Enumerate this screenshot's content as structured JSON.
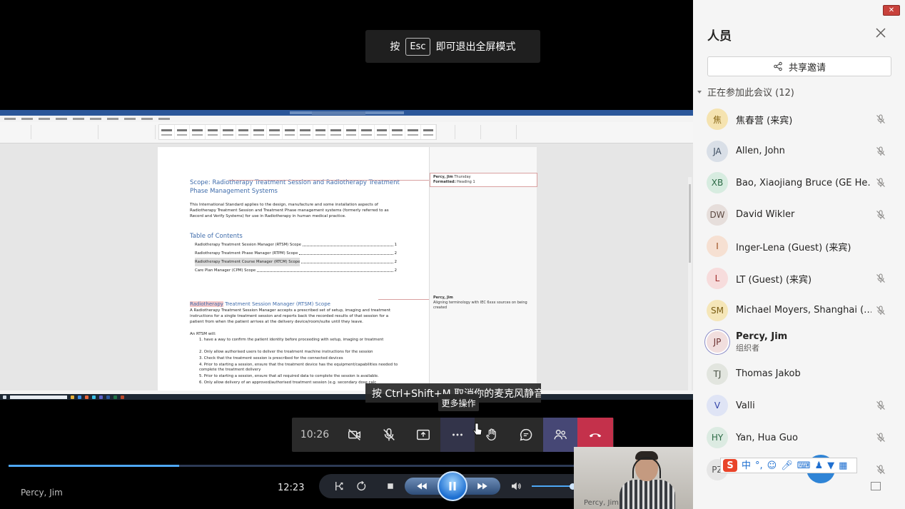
{
  "banner": {
    "prefix": "按",
    "key": "Esc",
    "suffix": "即可退出全屏模式"
  },
  "document": {
    "heading1": "Scope: Radiotherapy Treatment Session and Radiotherapy Treatment Phase Management Systems",
    "intro": "This International Standard applies to the design, manufacture and some installation aspects of Radiotherapy Treatment Session and Treatment Phase management systems (formerly referred to as Record and Verify Systems) for use in Radiotherapy in human medical practice.",
    "toc_title": "Table of Contents",
    "toc": [
      {
        "text": "Radiotherapy Treatment Session Manager (RTSM) Scope",
        "page": "1"
      },
      {
        "text": "Radiotherapy Treatment Phase Manager (RTPM) Scope",
        "page": "2"
      },
      {
        "text": "Radiotherapy Treatment Course Manager (RTCM) Scope",
        "page": "2"
      },
      {
        "text": "Care Plan Manager (CPM) Scope",
        "page": "2"
      }
    ],
    "heading2_a": "Radiotherapy",
    "heading2_b": " Treatment Session Manager (RTSM) Scope",
    "para2": "A Radiotherapy Treatment Session Manager accepts a prescribed set of setup, imaging and treatment instructions for a single treatment session and reports back the recorded results of that session for a patient from when the patient arrives at the delivery device/room/suite until they leave.",
    "rtsm_will": "An RTSM will:",
    "list": [
      "1.    have a way to confirm the patient identity before proceeding with setup, imaging or treatment",
      "2.    Only allow authorised users to deliver the treatment machine instructions for the session",
      "3.    Check that the treatment session is prescribed for the connected devices",
      "4.    Prior to starting a session, ensure that the treatment device has the equipment/capabilities needed to complete the treatment delivery",
      "5.    Prior to starting a session, ensure that all required data to complete the session is available.",
      "6.    Only allow delivery of an approved/authorised treatment session (e.g. secondary dose calc"
    ],
    "comment1_author": "Percy, Jim",
    "comment1_time": "Thursday",
    "comment1_label": "Formatted:",
    "comment1_value": "Heading 1",
    "comment2_author": "Percy, Jim",
    "comment2_text": "Aligning terminology with IEC 6xxx sources on being created"
  },
  "toast": "按 Ctrl+Shift+M 取消你的麦克风静音。",
  "tooltip": "更多操作",
  "controls": {
    "duration": "10:26"
  },
  "player": {
    "presenter": "Percy, Jim",
    "clock": "12:23",
    "progress": 0.25,
    "volume": 0.9
  },
  "self_name": "Percy, Jim",
  "panel": {
    "close_glyph": "✕",
    "title": "人员",
    "share_label": "共享邀请",
    "section_label": "正在参加此会议 (12)",
    "participants": [
      {
        "initials": "焦",
        "name": "焦春营 (来宾)",
        "muted": true,
        "bg": "#f5e3b0",
        "fg": "#8a6a1a"
      },
      {
        "initials": "JA",
        "name": "Allen, John",
        "muted": true,
        "bg": "#d9dfe7",
        "fg": "#3a4a5e"
      },
      {
        "initials": "XB",
        "name": "Bao, Xiaojiang Bruce (GE He…",
        "muted": true,
        "bg": "#d7ece0",
        "fg": "#2d6a45"
      },
      {
        "initials": "DW",
        "name": "David Wikler",
        "muted": true,
        "bg": "#e6dedb",
        "fg": "#5d4a42"
      },
      {
        "initials": "I",
        "name": "Inger-Lena (Guest) (来宾)",
        "muted": false,
        "bg": "#f6e0d2",
        "fg": "#9a4a1a"
      },
      {
        "initials": "L",
        "name": "LT (Guest) (来宾)",
        "muted": true,
        "bg": "#f7dcdc",
        "fg": "#a12e2e"
      },
      {
        "initials": "SM",
        "name": "Michael Moyers, Shanghai (…",
        "muted": true,
        "bg": "#f5e6b8",
        "fg": "#7a5d14"
      },
      {
        "initials": "JP",
        "name": "Percy, Jim",
        "sub": "组织者",
        "muted": false,
        "bold": true,
        "bg": "#f1dede",
        "fg": "#6b2f2f"
      },
      {
        "initials": "TJ",
        "name": "Thomas Jakob",
        "muted": false,
        "bg": "#e2e5df",
        "fg": "#4a5246"
      },
      {
        "initials": "V",
        "name": "Valli",
        "muted": true,
        "bg": "#dfe4f5",
        "fg": "#3344a8"
      },
      {
        "initials": "HY",
        "name": "Yan, Hua Guo",
        "muted": true,
        "bg": "#dcebe2",
        "fg": "#2d6a45"
      },
      {
        "initials": "PZ",
        "name": "",
        "muted": true,
        "bg": "#e6e6e6",
        "fg": "#555"
      }
    ]
  },
  "ime": {
    "logo": "S",
    "mode": "中",
    "punct": "°,"
  }
}
